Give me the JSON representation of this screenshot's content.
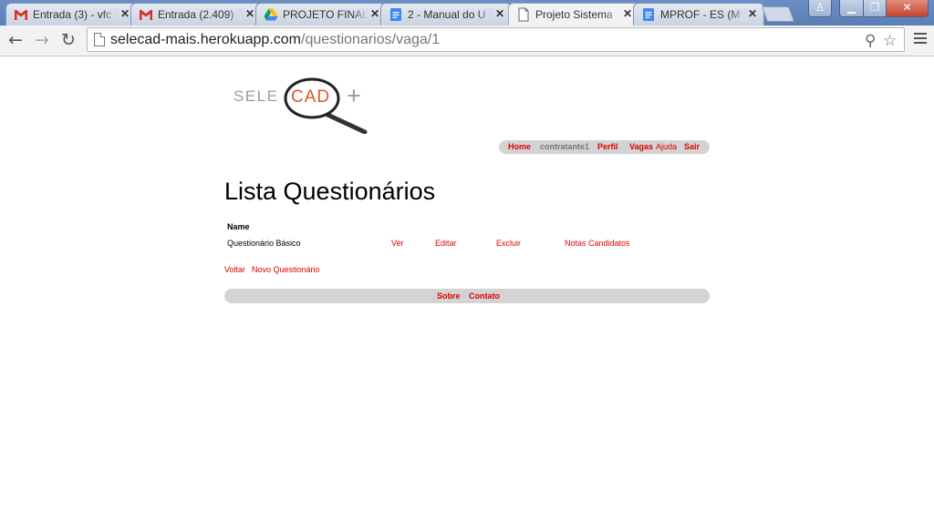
{
  "browser": {
    "tabs": [
      {
        "title": "Entrada (3) - vfc",
        "icon": "gmail-icon"
      },
      {
        "title": "Entrada (2.409)",
        "icon": "gmail-icon"
      },
      {
        "title": "PROJETO FINAL",
        "icon": "drive-icon"
      },
      {
        "title": "2 - Manual do U",
        "icon": "docs-icon"
      },
      {
        "title": "Projeto Sistema",
        "icon": "page-icon",
        "active": true
      },
      {
        "title": "MPROF - ES (M",
        "icon": "docs-icon"
      }
    ],
    "url_host": "selecad-mais.herokuapp.com",
    "url_path": "/questionarios/vaga/1"
  },
  "logo": {
    "left": "SELE",
    "center": "CAD",
    "plus": "+"
  },
  "nav": {
    "home": "Home",
    "user": "contratante1",
    "perfil": "Perfil",
    "vagas": "Vagas",
    "ajuda": "Ajuda",
    "sair": "Sair"
  },
  "main": {
    "title": "Lista Questionários",
    "table_header": "Name",
    "rows": [
      {
        "name": "Questionário Básico",
        "ver": "Ver",
        "editar": "Editar",
        "excluir": "Excluir",
        "notas": "Notas Candidatos"
      }
    ],
    "voltar": "Voltar",
    "novo": "Novo Questionário"
  },
  "footer": {
    "sobre": "Sobre",
    "contato": "Contato"
  },
  "colors": {
    "link": "#e00000",
    "bar": "#d3d3d3",
    "logo_accent": "#e0572a"
  }
}
